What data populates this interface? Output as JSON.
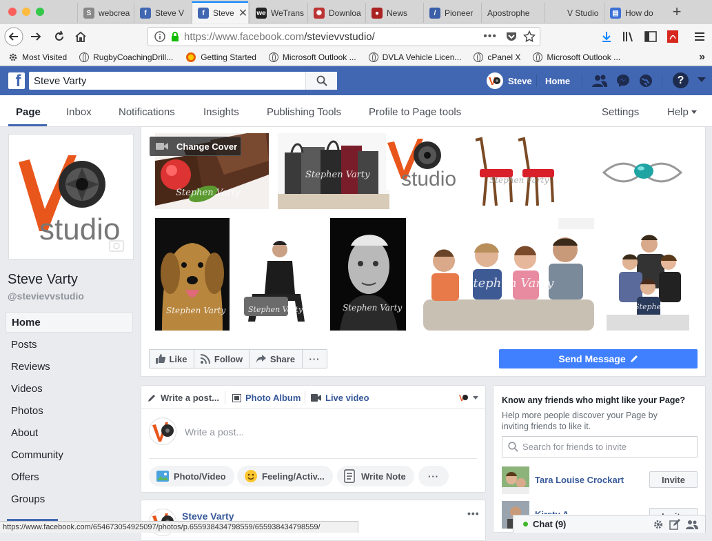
{
  "browser": {
    "tabs": [
      {
        "label": "webcrea",
        "icon": "spinner-icon"
      },
      {
        "label": "Steve V",
        "icon": "facebook-icon"
      },
      {
        "label": "Steve",
        "icon": "facebook-icon",
        "active": true
      },
      {
        "label": "WeTrans",
        "icon": "wetransfer-icon"
      },
      {
        "label": "Downloa",
        "icon": "download-site-icon"
      },
      {
        "label": "News",
        "icon": "news-icon"
      },
      {
        "label": "Pioneer",
        "icon": "pioneer-icon"
      },
      {
        "label": "Apostrophe",
        "icon": ""
      },
      {
        "label": "V Studio",
        "icon": ""
      },
      {
        "label": "How do",
        "icon": "chat-icon"
      }
    ],
    "url_base": "https://www.facebook.com",
    "url_path": "/stevievvstudio/",
    "bookmarks": [
      "Most Visited",
      "RugbyCoachingDrill...",
      "Getting Started",
      "Microsoft Outlook ...",
      "DVLA Vehicle Licen...",
      "cPanel X",
      "Microsoft Outlook ..."
    ],
    "status_url": "https://www.facebook.com/654673054925097/photos/p.655938434798559/655938434798559/"
  },
  "fb_header": {
    "search_value": "Steve Varty",
    "user_name": "Steve",
    "home_label": "Home",
    "brand_color": "#4267b2"
  },
  "page_nav": {
    "tabs": [
      "Page",
      "Inbox",
      "Notifications",
      "Insights",
      "Publishing Tools",
      "Profile to Page tools"
    ],
    "settings_label": "Settings",
    "help_label": "Help"
  },
  "profile": {
    "logo_letter": "V",
    "logo_word": "studio",
    "name": "Steve Varty",
    "handle": "@stevievvstudio"
  },
  "left_nav": [
    "Home",
    "Posts",
    "Reviews",
    "Videos",
    "Photos",
    "About",
    "Community",
    "Offers",
    "Groups"
  ],
  "cover": {
    "change_cover_label": "Change Cover",
    "watermark": "Stephen Varty",
    "logo_word": "studio"
  },
  "actions": {
    "like": "Like",
    "follow": "Follow",
    "share": "Share",
    "more": "···",
    "send_message": "Send Message"
  },
  "composer": {
    "write_post_tab": "Write a post...",
    "photo_album_tab": "Photo Album",
    "live_video_tab": "Live video",
    "placeholder": "Write a post...",
    "pills": [
      "Photo/Video",
      "Feeling/Activ...",
      "Write Note"
    ],
    "more": "···"
  },
  "post": {
    "author": "Steve Varty"
  },
  "invite": {
    "title": "Know any friends who might like your Page?",
    "desc": "Help more people discover your Page by inviting friends to like it.",
    "search_placeholder": "Search for friends to invite",
    "friends": [
      {
        "name": "Tara Louise Crockart",
        "button": "Invite"
      },
      {
        "name": "Kirsty A...",
        "button": "Invite"
      }
    ]
  },
  "chat": {
    "label": "Chat (9)"
  }
}
